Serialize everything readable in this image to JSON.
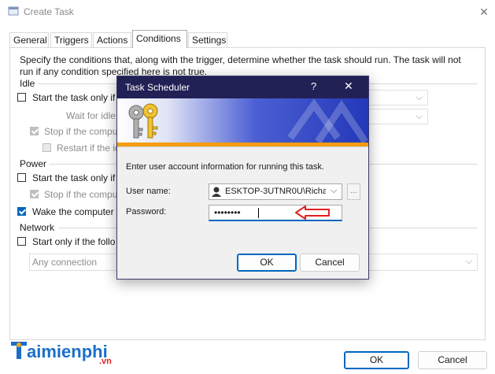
{
  "window": {
    "title": "Create Task"
  },
  "tabs": [
    "General",
    "Triggers",
    "Actions",
    "Conditions",
    "Settings"
  ],
  "conditions": {
    "description_line1": "Specify the conditions that, along with the trigger, determine whether the task should run.  The task will not",
    "description_line2": "run  if any condition specified here is not true.",
    "idle_group": "Idle",
    "idle_start": "Start the task only if",
    "wait_for_idle": "Wait for idle",
    "stop_if_computer": "Stop if the compu",
    "restart_if_idle": "Restart if the id",
    "power_group": "Power",
    "power_start": "Start the task only if",
    "power_stop": "Stop if the compu",
    "wake_computer": "Wake the computer",
    "network_group": "Network",
    "network_start": "Start only if the follo",
    "any_connection": "Any connection"
  },
  "buttons": {
    "ok": "OK",
    "cancel": "Cancel"
  },
  "dialog": {
    "title": "Task Scheduler",
    "help": "?",
    "close": "✕",
    "instruction": "Enter user account information for running this task.",
    "user_label": "User name:",
    "user_value": "ESKTOP-3UTNR0U\\Richard",
    "password_label": "Password:",
    "password_value": "••••••••",
    "browse": "...",
    "ok": "OK",
    "cancel": "Cancel"
  },
  "watermark": {
    "brand": "aimienphi",
    "domain": ".vn"
  },
  "colors": {
    "accent": "#0067c0",
    "dialog_title": "#222156",
    "arrow": "#e02020",
    "banner_stripe": "#f39c12"
  }
}
